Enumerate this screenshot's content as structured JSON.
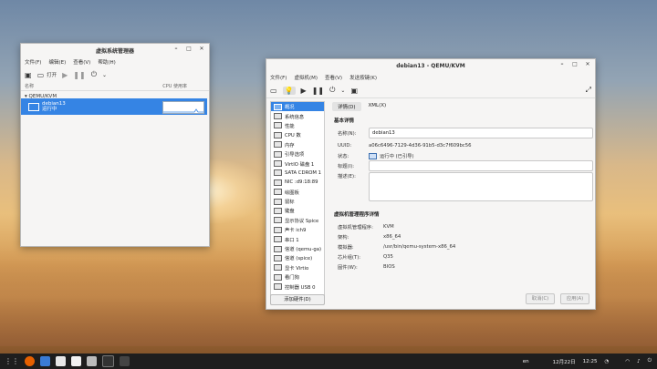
{
  "manager": {
    "title": "虚拟系统管理器",
    "menu": [
      "文件(F)",
      "编辑(E)",
      "查看(V)",
      "帮助(H)"
    ],
    "open_label": "打开",
    "col_name": "名称",
    "col_cpu": "CPU 使用率",
    "connection": "QEMU/KVM",
    "vm_name": "debian13",
    "vm_state": "运行中"
  },
  "details": {
    "title": "debian13 - QEMU/KVM",
    "menu": [
      "文件(F)",
      "虚拟机(M)",
      "查看(V)",
      "发送按键(K)"
    ],
    "sidebar": [
      "概况",
      "系统信息",
      "性能",
      "CPU 数",
      "内存",
      "引导选项",
      "VirtIO 磁盘 1",
      "SATA CDROM 1",
      "NIC :d9:18:89",
      "绘图板",
      "鼠标",
      "键盘",
      "显示协议 Spice",
      "声卡 ich9",
      "串口 1",
      "信道 (qemu-ga)",
      "信道 (spice)",
      "显卡 Virtio",
      "看门狗",
      "控制器 USB 0"
    ],
    "add_hw": "添加硬件(D)",
    "tabs": [
      "详情(D)",
      "XML(X)"
    ],
    "basic_title": "基本详情",
    "name_label": "名称(N):",
    "name_value": "debian13",
    "uuid_label": "UUID:",
    "uuid_value": "a06c6496-7129-4d36-91b5-d3c7f609bc56",
    "status_label": "状态:",
    "status_value": "运行中 (已引导)",
    "tag_label": "标题(I):",
    "desc_label": "描述(E):",
    "hyper_title": "虚拟机管理程序详情",
    "hyp_label": "虚拟机管理程序:",
    "hyp_value": "KVM",
    "arch_label": "架构:",
    "arch_value": "x86_64",
    "emu_label": "模拟器:",
    "emu_value": "/usr/bin/qemu-system-x86_64",
    "chip_label": "芯片组(T):",
    "chip_value": "Q35",
    "fw_label": "固件(W):",
    "fw_value": "BIOS",
    "cancel": "取消(C)",
    "apply": "应用(A)"
  },
  "taskbar": {
    "lang": "en",
    "date": "12月22日",
    "time": "12:25"
  },
  "colors": {
    "accent": "#3584e4",
    "taskbar": "#1e1e1e"
  }
}
